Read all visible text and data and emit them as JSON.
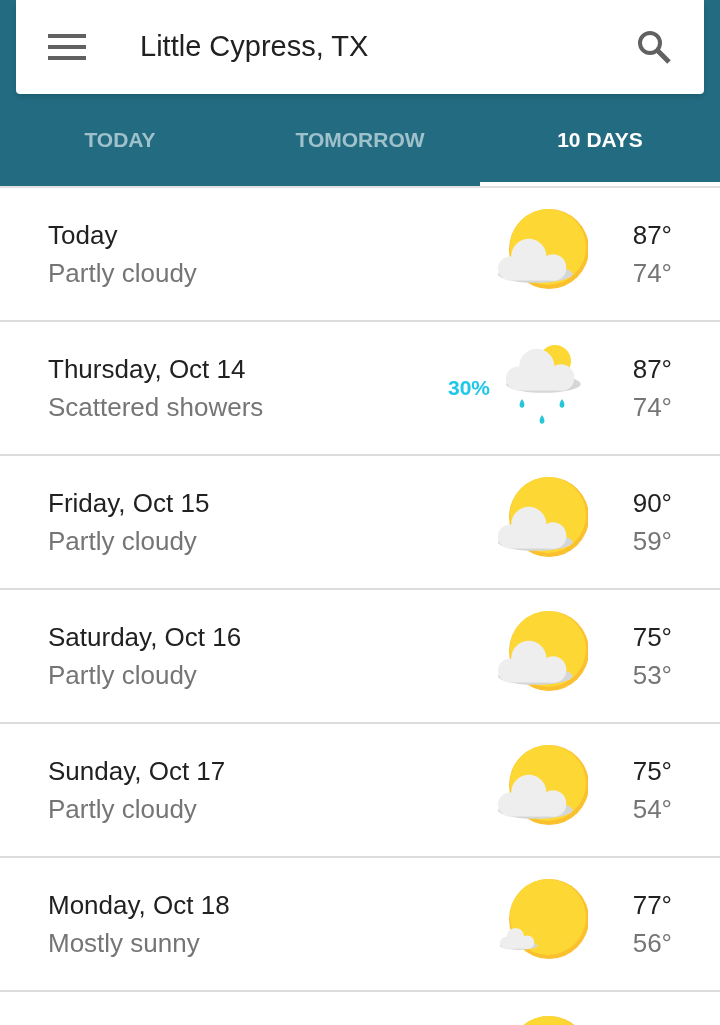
{
  "search": {
    "value": "Little Cypress, TX"
  },
  "tabs": [
    {
      "label": "TODAY",
      "selected": false
    },
    {
      "label": "TOMORROW",
      "selected": false
    },
    {
      "label": "10 DAYS",
      "selected": true
    }
  ],
  "days": [
    {
      "day": "Today",
      "condition": "Partly cloudy",
      "kind": "partly_cloudy",
      "high": "87°",
      "low": "74°"
    },
    {
      "day": "Thursday, Oct 14",
      "condition": "Scattered showers",
      "kind": "showers",
      "precip": "30%",
      "high": "87°",
      "low": "74°"
    },
    {
      "day": "Friday, Oct 15",
      "condition": "Partly cloudy",
      "kind": "partly_cloudy",
      "high": "90°",
      "low": "59°"
    },
    {
      "day": "Saturday, Oct 16",
      "condition": "Partly cloudy",
      "kind": "partly_cloudy",
      "high": "75°",
      "low": "53°"
    },
    {
      "day": "Sunday, Oct 17",
      "condition": "Partly cloudy",
      "kind": "partly_cloudy",
      "high": "75°",
      "low": "54°"
    },
    {
      "day": "Monday, Oct 18",
      "condition": "Mostly sunny",
      "kind": "mostly_sunny",
      "high": "77°",
      "low": "56°"
    },
    {
      "kind": "sunny"
    }
  ]
}
